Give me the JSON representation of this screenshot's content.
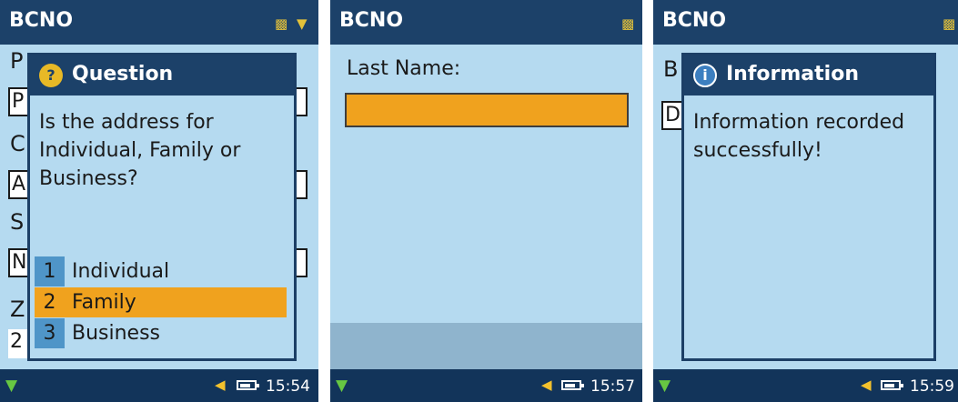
{
  "screens": [
    {
      "app_title": "BCNO",
      "title_icons": [
        "contacts-icon",
        "signal-icon"
      ],
      "background_labels": [
        "P",
        "C",
        "S",
        "Z"
      ],
      "background_fields": [
        "P",
        "A",
        "N",
        "2"
      ],
      "dialog": {
        "icon": "question-icon",
        "icon_glyph": "?",
        "icon_color": "#e8b926",
        "title": "Question",
        "text": "Is the address for Individual, Family or Business?",
        "options": [
          {
            "number": "1",
            "label": "Individual",
            "selected": false
          },
          {
            "number": "2",
            "label": "Family",
            "selected": true
          },
          {
            "number": "3",
            "label": "Business",
            "selected": false
          }
        ]
      },
      "taskbar": {
        "clock": "15:54",
        "network_icon": "network-icon",
        "volume_icon": "volume-icon",
        "battery_icon": "battery-icon"
      }
    },
    {
      "app_title": "BCNO",
      "title_icons": [
        "contacts-icon"
      ],
      "field_label": "Last Name:",
      "field_value": "",
      "taskbar": {
        "clock": "15:57",
        "network_icon": "network-icon",
        "volume_icon": "volume-icon",
        "battery_icon": "battery-icon"
      }
    },
    {
      "app_title": "BCNO",
      "title_icons": [
        "contacts-icon"
      ],
      "background_labels": [
        "B"
      ],
      "background_fields": [
        "D"
      ],
      "dialog": {
        "icon": "info-icon",
        "icon_glyph": "i",
        "icon_color": "#ffffff",
        "title": "Information",
        "text": "Information recorded successfully!"
      },
      "taskbar": {
        "clock": "15:59",
        "network_icon": "network-icon",
        "volume_icon": "volume-icon",
        "battery_icon": "battery-icon"
      }
    }
  ],
  "colors": {
    "title_bar": "#1c4169",
    "screen_bg": "#b5daf0",
    "highlight": "#f0a21e",
    "option_number_bg": "#4f95c8",
    "taskbar": "#12345a"
  }
}
